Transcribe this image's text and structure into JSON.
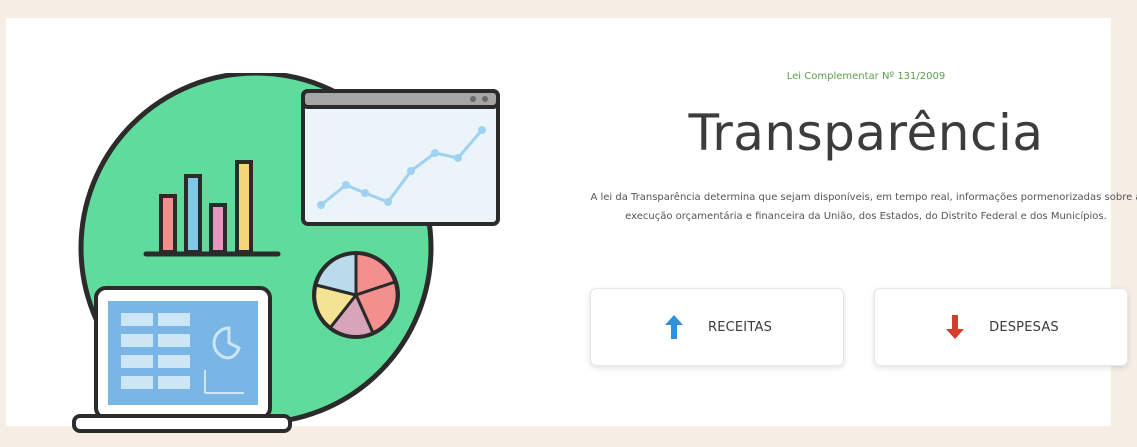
{
  "header": {
    "eyebrow": "Lei Complementar Nº 131/2009",
    "title": "Transparência",
    "description": "A lei da Transparência determina que sejam disponíveis, em tempo real, informações pormenorizadas sobre a execução orçamentária e financeira da União, dos Estados, do Distrito Federal e dos Municípios."
  },
  "actions": {
    "receitas": {
      "label": "RECEITAS",
      "icon": "arrow-up-icon",
      "color": "#2f90db"
    },
    "despesas": {
      "label": "DESPESAS",
      "icon": "arrow-down-icon",
      "color": "#d63b2f"
    }
  },
  "theme": {
    "page_background": "#f6ede4",
    "card_background": "#ffffff",
    "eyebrow_color": "#5c9f48",
    "circle_color": "#5fdb9c"
  }
}
